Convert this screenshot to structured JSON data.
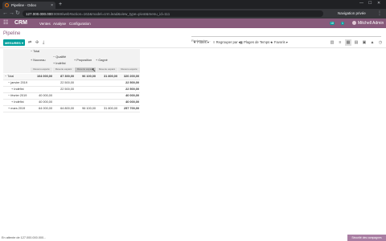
{
  "browser": {
    "tab_title": "Pipeline - Odoo",
    "tab_close": "×",
    "new_tab": "+",
    "url_host": "127.000.000.000",
    "url_rest": ":8069/web#action=162&model=crm.lead&view_type=pivot&menu_id=111",
    "incognito_label": "Navigation privée",
    "back": "←",
    "forward": "→",
    "reload": "↻",
    "menu": "⋮",
    "minimize": "—",
    "maximize": "☐",
    "close": "✕"
  },
  "odoo_nav": {
    "apps_icon": "☷",
    "brand": "CRM",
    "menu": [
      "Ventes",
      "Analyse",
      "Configuration"
    ],
    "badge1": "18",
    "badge2": "1",
    "user": "Mitchell Admin"
  },
  "control_panel": {
    "breadcrumb": "Pipeline",
    "search_placeholder": "Rechercher...",
    "mesures": "MESURES ▾",
    "filters": "▼ Filtres ▾",
    "group_by": "≡ Regrouper par ▾",
    "periods": "▦ Plages de Temps ▾",
    "favorites": "★ Favoris ▾"
  },
  "pivot": {
    "col_total": "Total",
    "col_stages": [
      "Nouveau",
      "Qualifié",
      "Proposition",
      "Gagné"
    ],
    "col_stage_sub": "Indéfini",
    "measure": "Revenu espéré",
    "rows": [
      {
        "label": "Total",
        "values": [
          "104 000,00",
          "87 300,00",
          "96 100,00",
          "31 800,00",
          "320 200,00"
        ],
        "total": true
      },
      {
        "label": "janvier 2019",
        "values": [
          "",
          "22 500,00",
          "",
          "",
          "22 500,00"
        ]
      },
      {
        "label": "Indéfini",
        "values": [
          "",
          "22 500,00",
          "",
          "",
          "22 500,00"
        ]
      },
      {
        "label": "février 2019",
        "values": [
          "40 000,00",
          "",
          "",
          "",
          "40 000,00"
        ]
      },
      {
        "label": "Indéfini",
        "values": [
          "40 000,00",
          "",
          "",
          "",
          "40 000,00"
        ]
      },
      {
        "label": "mars 2019",
        "values": [
          "64 000,00",
          "64 800,00",
          "96 100,00",
          "31 800,00",
          "257 700,00"
        ]
      }
    ]
  },
  "status_bar": "En attente de 127.000.000.000...",
  "promo": "Sécurité des campagnes"
}
